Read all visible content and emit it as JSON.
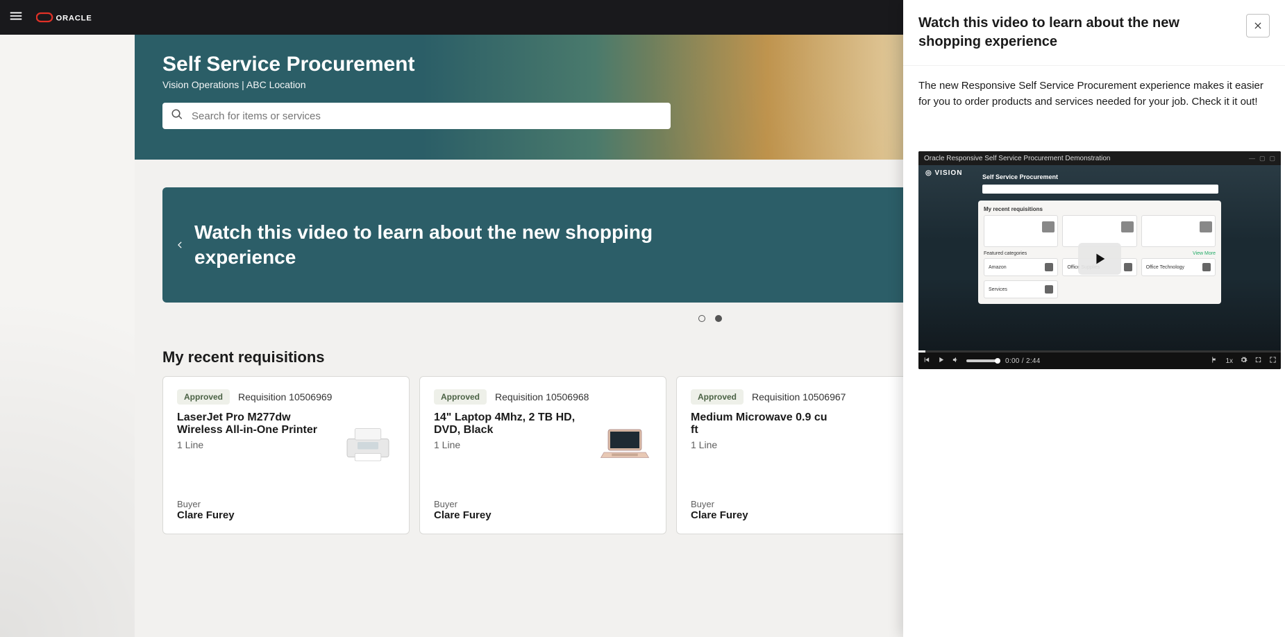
{
  "icons": {
    "hamburger": "menu-icon",
    "search": "search-icon",
    "close": "close-icon",
    "chevron_left": "chevron-left-icon",
    "chevron_right": "chevron-right-icon",
    "play_small": "play-icon",
    "volume": "volume-icon",
    "flag": "flag-icon",
    "gear": "gear-icon",
    "expand": "expand-icon",
    "fullscreen": "fullscreen-icon"
  },
  "header": {
    "logo_text": "ORACLE"
  },
  "hero": {
    "title": "Self Service Procurement",
    "subtitle": "Vision Operations | ABC Location",
    "search_placeholder": "Search for items or services"
  },
  "carousel": {
    "text": "Watch this video to learn about the new shopping experience",
    "active_dot_index": 1,
    "dot_count": 2
  },
  "section": {
    "title": "My recent requisitions",
    "cards": [
      {
        "status": "Approved",
        "req_label": "Requisition 10506969",
        "title": "LaserJet Pro M277dw Wireless All-in-One Printer",
        "lines": "1 Line",
        "buyer_label": "Buyer",
        "buyer_name": "Clare Furey",
        "thumb": "printer"
      },
      {
        "status": "Approved",
        "req_label": "Requisition 10506968",
        "title": "14\" Laptop 4Mhz, 2 TB HD, DVD, Black",
        "lines": "1 Line",
        "buyer_label": "Buyer",
        "buyer_name": "Clare Furey",
        "thumb": "laptop"
      },
      {
        "status": "Approved",
        "req_label": "Requisition 10506967",
        "title": "Medium Microwave 0.9 cu ft",
        "lines": "1 Line",
        "buyer_label": "Buyer",
        "buyer_name": "Clare Furey",
        "thumb": "none"
      }
    ]
  },
  "panel": {
    "title": "Watch this video to learn about the new shopping experience",
    "description": "The new Responsive Self Service Procurement experience makes it easier for you to order products and services needed for your job.  Check it it out!"
  },
  "video": {
    "window_title": "Oracle Responsive Self Service Procurement Demonstration",
    "brand_in_video": "VISION",
    "mock_app_title": "Self Service Procurement",
    "mock_section": "My recent requisitions",
    "mock_categories_label": "Featured categories",
    "mock_view_more": "View More",
    "mock_cats": [
      "Amazon",
      "Office Supplies",
      "Office Technology",
      "Services"
    ],
    "time_current": "0:00",
    "time_sep": "/",
    "time_total": "2:44",
    "speed": "1x"
  },
  "colors": {
    "global_header_bg": "#19191c",
    "hero_navy": "#2c5e68",
    "badge_bg": "#eef0e9",
    "badge_text": "#4b6245"
  }
}
